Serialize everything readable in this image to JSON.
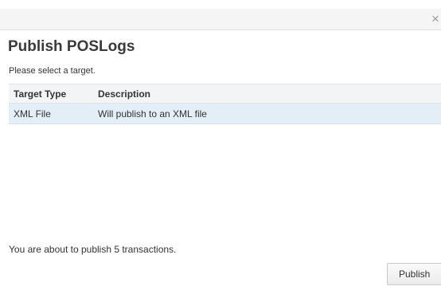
{
  "dialog": {
    "title": "Publish POSLogs",
    "close_icon": "close-icon",
    "close_glyph": "×"
  },
  "instructions": "Please select a target.",
  "table": {
    "columns": [
      "Target Type",
      "Description"
    ],
    "rows": [
      {
        "type": "XML File",
        "description": "Will publish to an XML file",
        "selected": true
      }
    ]
  },
  "status": "You are about to publish 5 transactions.",
  "actions": {
    "publish_label": "Publish"
  },
  "colors": {
    "selected_row": "#e3eef7",
    "header_bg": "#f2f4f6",
    "titlebar_bg": "#f5f5f5"
  }
}
